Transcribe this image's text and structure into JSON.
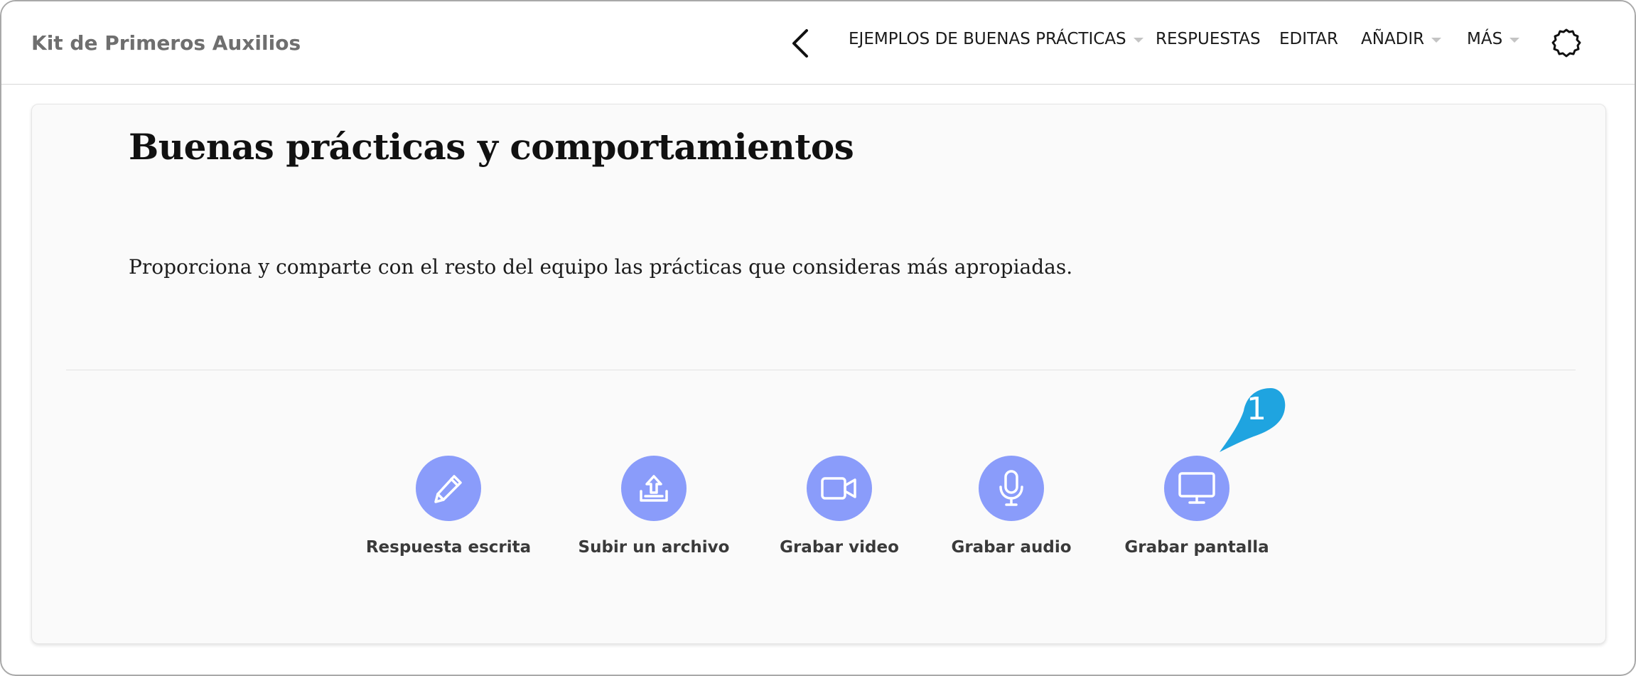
{
  "app": {
    "title": "Kit de Primeros Auxilios"
  },
  "nav": {
    "items": [
      {
        "label": "EJEMPLOS DE BUENAS PRÁCTICAS",
        "has_dropdown": true
      },
      {
        "label": "RESPUESTAS",
        "has_dropdown": false
      },
      {
        "label": "EDITAR",
        "has_dropdown": false
      },
      {
        "label": "AÑADIR",
        "has_dropdown": true
      },
      {
        "label": "MÁS",
        "has_dropdown": true
      }
    ],
    "back_icon": "chevron-left-icon",
    "settings_icon": "gear-outline-icon"
  },
  "page": {
    "title": "Buenas prácticas y comportamientos",
    "description": "Proporciona y comparte con el resto del equipo las prácticas que consideras más apropiadas."
  },
  "actions": [
    {
      "label": "Respuesta escrita",
      "icon": "pencil-icon"
    },
    {
      "label": "Subir un archivo",
      "icon": "upload-icon"
    },
    {
      "label": "Grabar video",
      "icon": "video-camera-icon"
    },
    {
      "label": "Grabar audio",
      "icon": "microphone-icon"
    },
    {
      "label": "Grabar pantalla",
      "icon": "monitor-icon"
    }
  ],
  "callout": {
    "number": "1"
  },
  "colors": {
    "action_circle": "#8a9cfa",
    "callout": "#1fa4e0",
    "header_title": "#6f6f6f"
  }
}
